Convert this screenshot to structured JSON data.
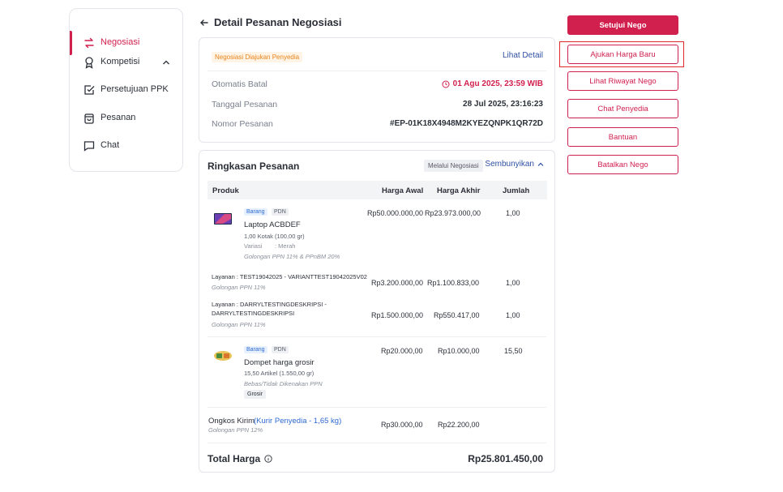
{
  "sidebar": {
    "items": [
      {
        "label": "Negosiasi"
      },
      {
        "label": "Kompetisi"
      },
      {
        "label": "Persetujuan PPK"
      },
      {
        "label": "Pesanan"
      },
      {
        "label": "Chat"
      }
    ]
  },
  "header": {
    "title": "Detail Pesanan Negosiasi"
  },
  "summary": {
    "status_badge": "Negosiasi Diajukan Penyedia",
    "detail_link": "Lihat Detail",
    "auto_cancel_label": "Otomatis Batal",
    "auto_cancel_value": "01 Agu 2025, 23:59 WIB",
    "order_date_label": "Tanggal Pesanan",
    "order_date_value": "28 Jul 2025, 23:16:23",
    "order_no_label": "Nomor Pesanan",
    "order_no_value": "#EP-01K18X4948M2KYEZQNPK1QR72D"
  },
  "ringkasan": {
    "title": "Ringkasan Pesanan",
    "via_badge": "Melalui Negosiasi",
    "hide_link": "Sembunyikan",
    "columns": [
      "Produk",
      "Harga Awal",
      "Harga Akhir",
      "Jumlah"
    ],
    "product1": {
      "tag1": "Barang",
      "tag2": "PDN",
      "name": "Laptop ACBDEF",
      "qty_desc": "1,00 Kotak (100,00 gr)",
      "variant_label": "Variasi",
      "variant_value": ": Merah",
      "tax": "Golongan PPN 11% & PPnBM 20%",
      "harga_awal": "Rp50.000.000,00",
      "harga_akhir": "Rp23.973.000,00",
      "jumlah": "1,00"
    },
    "service1": {
      "name": "Layanan : TEST19042025 - VARIANTTEST19042025V02",
      "tax": "Golongan PPN 11%",
      "harga_awal": "Rp3.200.000,00",
      "harga_akhir": "Rp1.100.833,00",
      "jumlah": "1,00"
    },
    "service2": {
      "name_line1": "Layanan : DARRYLTESTINGDESKRIPSI -",
      "name_line2": "DARRYLTESTINGDESKRIPSI",
      "tax": "Golongan PPN 11%",
      "harga_awal": "Rp1.500.000,00",
      "harga_akhir": "Rp550.417,00",
      "jumlah": "1,00"
    },
    "product2": {
      "tag1": "Barang",
      "tag2": "PDN",
      "name": "Dompet harga grosir",
      "qty_desc": "15,50 Artikel (1.550,00 gr)",
      "tax": "Bebas/Tidak Dikenakan PPN",
      "grosir": "Grosir",
      "harga_awal": "Rp20.000,00",
      "harga_akhir": "Rp10.000,00",
      "jumlah": "15,50"
    },
    "shipping": {
      "label": "Ongkos Kirim",
      "courier": "(Kurir Penyedia - 1,65 kg)",
      "tax": "Golongan PPN 12%",
      "harga_awal": "Rp30.000,00",
      "harga_akhir": "Rp22.200,00"
    },
    "total_label": "Total Harga",
    "total_value": "Rp25.801.450,00"
  },
  "actions": {
    "approve": "Setujui Nego",
    "propose": "Ajukan Harga Baru",
    "history": "Lihat Riwayat Nego",
    "chat": "Chat Penyedia",
    "help": "Bantuan",
    "cancel": "Batalkan Nego"
  },
  "colors": {
    "accent": "#d11f4e",
    "link": "#2d4fa3",
    "warning": "#e8831b"
  }
}
